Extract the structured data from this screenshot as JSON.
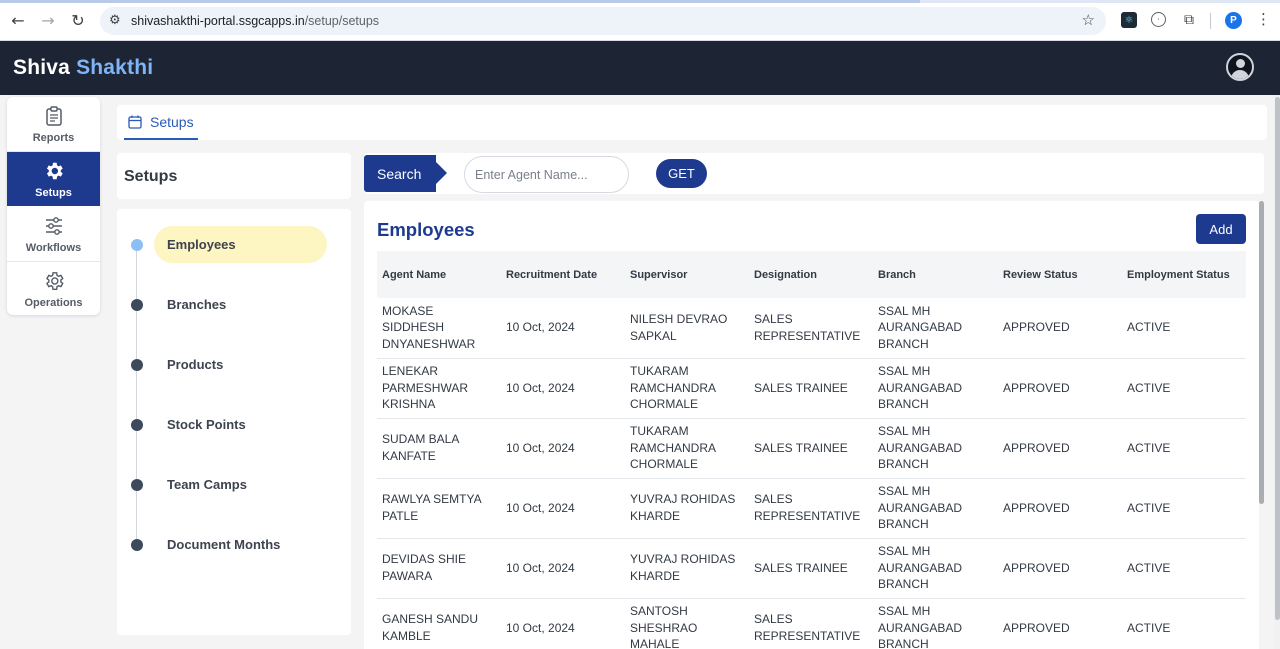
{
  "browser": {
    "url_host": "shivashakthi-portal.ssgcapps.in",
    "url_path": "/setup/setups",
    "profile_initial": "P"
  },
  "brand": {
    "part1": "Shiva ",
    "part2": "Shakthi",
    "accent_color": "#7fb4f5"
  },
  "rail": {
    "items": [
      {
        "label": "Reports",
        "icon": "clipboard-icon",
        "active": false
      },
      {
        "label": "Setups",
        "icon": "gear-icon",
        "active": true
      },
      {
        "label": "Workflows",
        "icon": "sliders-icon",
        "active": false
      },
      {
        "label": "Operations",
        "icon": "cog-outline-icon",
        "active": false
      }
    ]
  },
  "breadcrumb": {
    "label": "Setups",
    "icon": "calendar-icon"
  },
  "setups_menu": {
    "title": "Setups",
    "items": [
      {
        "label": "Employees",
        "active": true
      },
      {
        "label": "Branches",
        "active": false
      },
      {
        "label": "Products",
        "active": false
      },
      {
        "label": "Stock Points",
        "active": false
      },
      {
        "label": "Team Camps",
        "active": false
      },
      {
        "label": "Document Months",
        "active": false
      }
    ]
  },
  "search": {
    "label": "Search",
    "placeholder": "Enter Agent Name...",
    "value": "",
    "button": "GET"
  },
  "employees": {
    "title": "Employees",
    "add_label": "Add",
    "columns": [
      "Agent Name",
      "Recruitment Date",
      "Supervisor",
      "Designation",
      "Branch",
      "Review Status",
      "Employment Status"
    ],
    "rows": [
      [
        "MOKASE SIDDHESH DNYANESHWAR",
        "10 Oct, 2024",
        "NILESH DEVRAO SAPKAL",
        "SALES REPRESENTATIVE",
        "SSAL MH AURANGABAD BRANCH",
        "APPROVED",
        "ACTIVE"
      ],
      [
        "LENEKAR PARMESHWAR KRISHNA",
        "10 Oct, 2024",
        "TUKARAM RAMCHANDRA CHORMALE",
        "SALES TRAINEE",
        "SSAL MH AURANGABAD BRANCH",
        "APPROVED",
        "ACTIVE"
      ],
      [
        "SUDAM BALA KANFATE",
        "10 Oct, 2024",
        "TUKARAM RAMCHANDRA CHORMALE",
        "SALES TRAINEE",
        "SSAL MH AURANGABAD BRANCH",
        "APPROVED",
        "ACTIVE"
      ],
      [
        "RAWLYA SEMTYA PATLE",
        "10 Oct, 2024",
        "YUVRAJ ROHIDAS KHARDE",
        "SALES REPRESENTATIVE",
        "SSAL MH AURANGABAD BRANCH",
        "APPROVED",
        "ACTIVE"
      ],
      [
        "DEVIDAS SHIE PAWARA",
        "10 Oct, 2024",
        "YUVRAJ ROHIDAS KHARDE",
        "SALES TRAINEE",
        "SSAL MH AURANGABAD BRANCH",
        "APPROVED",
        "ACTIVE"
      ],
      [
        "GANESH SANDU KAMBLE",
        "10 Oct, 2024",
        "SANTOSH SHESHRAO MAHALE",
        "SALES REPRESENTATIVE",
        "SSAL MH AURANGABAD BRANCH",
        "APPROVED",
        "ACTIVE"
      ]
    ]
  },
  "colors": {
    "primary": "#1d3a8f",
    "header_bg": "#1d2535",
    "active_pill": "#fdf5c2",
    "active_dot": "#8cc0f4"
  }
}
